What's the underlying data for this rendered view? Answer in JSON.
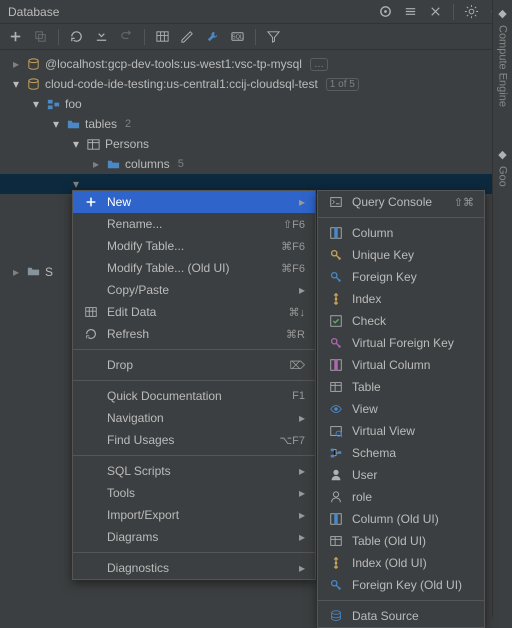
{
  "panel": {
    "title": "Database"
  },
  "title_icons": [
    "target",
    "collapse",
    "split",
    "sep",
    "gear",
    "minimize"
  ],
  "toolbar_icons": [
    "add",
    "copy-disabled",
    "refresh",
    "stop-filter",
    "play",
    "grid",
    "pencil",
    "wrench",
    "sql",
    "sep",
    "filter"
  ],
  "tree": {
    "conn1": {
      "label": "@localhost:gcp-dev-tools:us-west1:vsc-tp-mysql",
      "badge": "…"
    },
    "conn2": {
      "label": "cloud-code-ide-testing:us-central1:ccij-cloudsql-test",
      "badge": "1 of 5"
    },
    "db": "foo",
    "tables_label": "tables",
    "tables_count": "2",
    "table1": "Persons",
    "cols_label": "columns",
    "cols_count": "5",
    "hidden_schema_prefix": "S"
  },
  "menu": [
    {
      "ico": "plus",
      "label": "New",
      "sub": true,
      "sel": true
    },
    {
      "ico": "",
      "label": "Rename...",
      "short": "⇧F6"
    },
    {
      "ico": "",
      "label": "Modify Table...",
      "short": "⌘F6"
    },
    {
      "ico": "",
      "label": "Modify Table... (Old UI)",
      "short": "⌘F6"
    },
    {
      "ico": "",
      "label": "Copy/Paste",
      "sub": true
    },
    {
      "ico": "grid",
      "label": "Edit Data",
      "short": "⌘↓"
    },
    {
      "ico": "refresh",
      "label": "Refresh",
      "short": "⌘R"
    },
    {
      "div": true
    },
    {
      "ico": "",
      "label": "Drop",
      "short": "⌦"
    },
    {
      "div": true
    },
    {
      "ico": "",
      "label": "Quick Documentation",
      "short": "F1"
    },
    {
      "ico": "",
      "label": "Navigation",
      "sub": true
    },
    {
      "ico": "",
      "label": "Find Usages",
      "short": "⌥F7"
    },
    {
      "div": true
    },
    {
      "ico": "",
      "label": "SQL Scripts",
      "sub": true
    },
    {
      "ico": "",
      "label": "Tools",
      "sub": true
    },
    {
      "ico": "",
      "label": "Import/Export",
      "sub": true
    },
    {
      "ico": "",
      "label": "Diagrams",
      "sub": true
    },
    {
      "div": true
    },
    {
      "ico": "",
      "label": "Diagnostics",
      "sub": true
    }
  ],
  "submenu": [
    {
      "ico": "console",
      "label": "Query Console",
      "short": "⇧⌘"
    },
    {
      "div": true
    },
    {
      "ico": "column",
      "label": "Column"
    },
    {
      "ico": "ukey",
      "label": "Unique Key"
    },
    {
      "ico": "fkey",
      "label": "Foreign Key"
    },
    {
      "ico": "index",
      "label": "Index"
    },
    {
      "ico": "check",
      "label": "Check"
    },
    {
      "ico": "vfkey",
      "label": "Virtual Foreign Key"
    },
    {
      "ico": "vcol",
      "label": "Virtual Column"
    },
    {
      "ico": "table",
      "label": "Table"
    },
    {
      "ico": "view",
      "label": "View"
    },
    {
      "ico": "vview",
      "label": "Virtual View"
    },
    {
      "ico": "schema",
      "label": "Schema"
    },
    {
      "ico": "user",
      "label": "User"
    },
    {
      "ico": "role",
      "label": "role"
    },
    {
      "ico": "column",
      "label": "Column (Old UI)"
    },
    {
      "ico": "table",
      "label": "Table (Old UI)"
    },
    {
      "ico": "index",
      "label": "Index (Old UI)"
    },
    {
      "ico": "fkey",
      "label": "Foreign Key (Old UI)"
    },
    {
      "div": true
    },
    {
      "ico": "datasource",
      "label": "Data Source"
    }
  ],
  "sidebar": {
    "s1": "Compute Engine",
    "s2": "Goo"
  }
}
